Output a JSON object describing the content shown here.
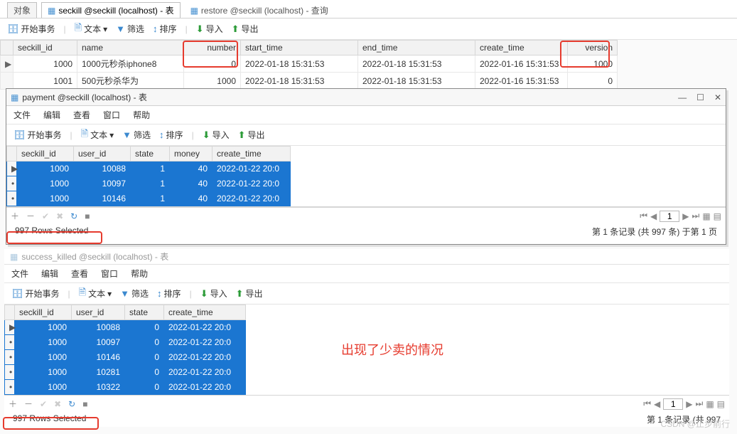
{
  "top_tabs": {
    "tab1_label": "对象",
    "tab2_label": "seckill @seckill (localhost) - 表",
    "tab3_label": "restore @seckill (localhost) - 查询"
  },
  "toolbar": {
    "start_tx": "开始事务",
    "text": "文本",
    "filter": "筛选",
    "sort": "排序",
    "import": "导入",
    "export": "导出"
  },
  "seckill_table": {
    "headers": {
      "seckill_id": "seckill_id",
      "name": "name",
      "number": "number",
      "start_time": "start_time",
      "end_time": "end_time",
      "create_time": "create_time",
      "version": "version"
    },
    "rows": [
      {
        "mark": "▶",
        "seckill_id": "1000",
        "name": "1000元秒杀iphone8",
        "number": "0",
        "start_time": "2022-01-18 15:31:53",
        "end_time": "2022-01-18 15:31:53",
        "create_time": "2022-01-16 15:31:53",
        "version": "1000"
      },
      {
        "mark": "",
        "seckill_id": "1001",
        "name": "500元秒杀华为",
        "number": "1000",
        "start_time": "2022-01-18 15:31:53",
        "end_time": "2022-01-18 15:31:53",
        "create_time": "2022-01-16 15:31:53",
        "version": "0"
      }
    ]
  },
  "payment_window": {
    "title": "payment @seckill (localhost) - 表",
    "menus": {
      "file": "文件",
      "edit": "编辑",
      "view": "查看",
      "window": "窗口",
      "help": "帮助"
    },
    "headers": {
      "seckill_id": "seckill_id",
      "user_id": "user_id",
      "state": "state",
      "money": "money",
      "create_time": "create_time"
    },
    "rows": [
      {
        "mark": "▶",
        "seckill_id": "1000",
        "user_id": "10088",
        "state": "1",
        "money": "40",
        "create_time": "2022-01-22 20:0"
      },
      {
        "mark": "•",
        "seckill_id": "1000",
        "user_id": "10097",
        "state": "1",
        "money": "40",
        "create_time": "2022-01-22 20:0"
      },
      {
        "mark": "•",
        "seckill_id": "1000",
        "user_id": "10146",
        "state": "1",
        "money": "40",
        "create_time": "2022-01-22 20:0"
      }
    ],
    "pager": {
      "page": "1",
      "summary": "第 1 条记录 (共 997 条) 于第 1 页"
    },
    "status": "997 Rows Selected"
  },
  "success_killed": {
    "title": "success_killed @seckill (localhost) - 表",
    "menus": {
      "file": "文件",
      "edit": "编辑",
      "view": "查看",
      "window": "窗口",
      "help": "帮助"
    },
    "headers": {
      "seckill_id": "seckill_id",
      "user_id": "user_id",
      "state": "state",
      "create_time": "create_time"
    },
    "rows": [
      {
        "mark": "▶",
        "seckill_id": "1000",
        "user_id": "10088",
        "state": "0",
        "create_time": "2022-01-22 20:0"
      },
      {
        "mark": "•",
        "seckill_id": "1000",
        "user_id": "10097",
        "state": "0",
        "create_time": "2022-01-22 20:0"
      },
      {
        "mark": "•",
        "seckill_id": "1000",
        "user_id": "10146",
        "state": "0",
        "create_time": "2022-01-22 20:0"
      },
      {
        "mark": "•",
        "seckill_id": "1000",
        "user_id": "10281",
        "state": "0",
        "create_time": "2022-01-22 20:0"
      },
      {
        "mark": "•",
        "seckill_id": "1000",
        "user_id": "10322",
        "state": "0",
        "create_time": "2022-01-22 20:0"
      }
    ],
    "pager": {
      "page": "1",
      "summary": "第 1 条记录 (共 997"
    },
    "status": "997 Rows Selected"
  },
  "annotation": "出现了少卖的情况",
  "watermark": "CSDN @止步前行"
}
